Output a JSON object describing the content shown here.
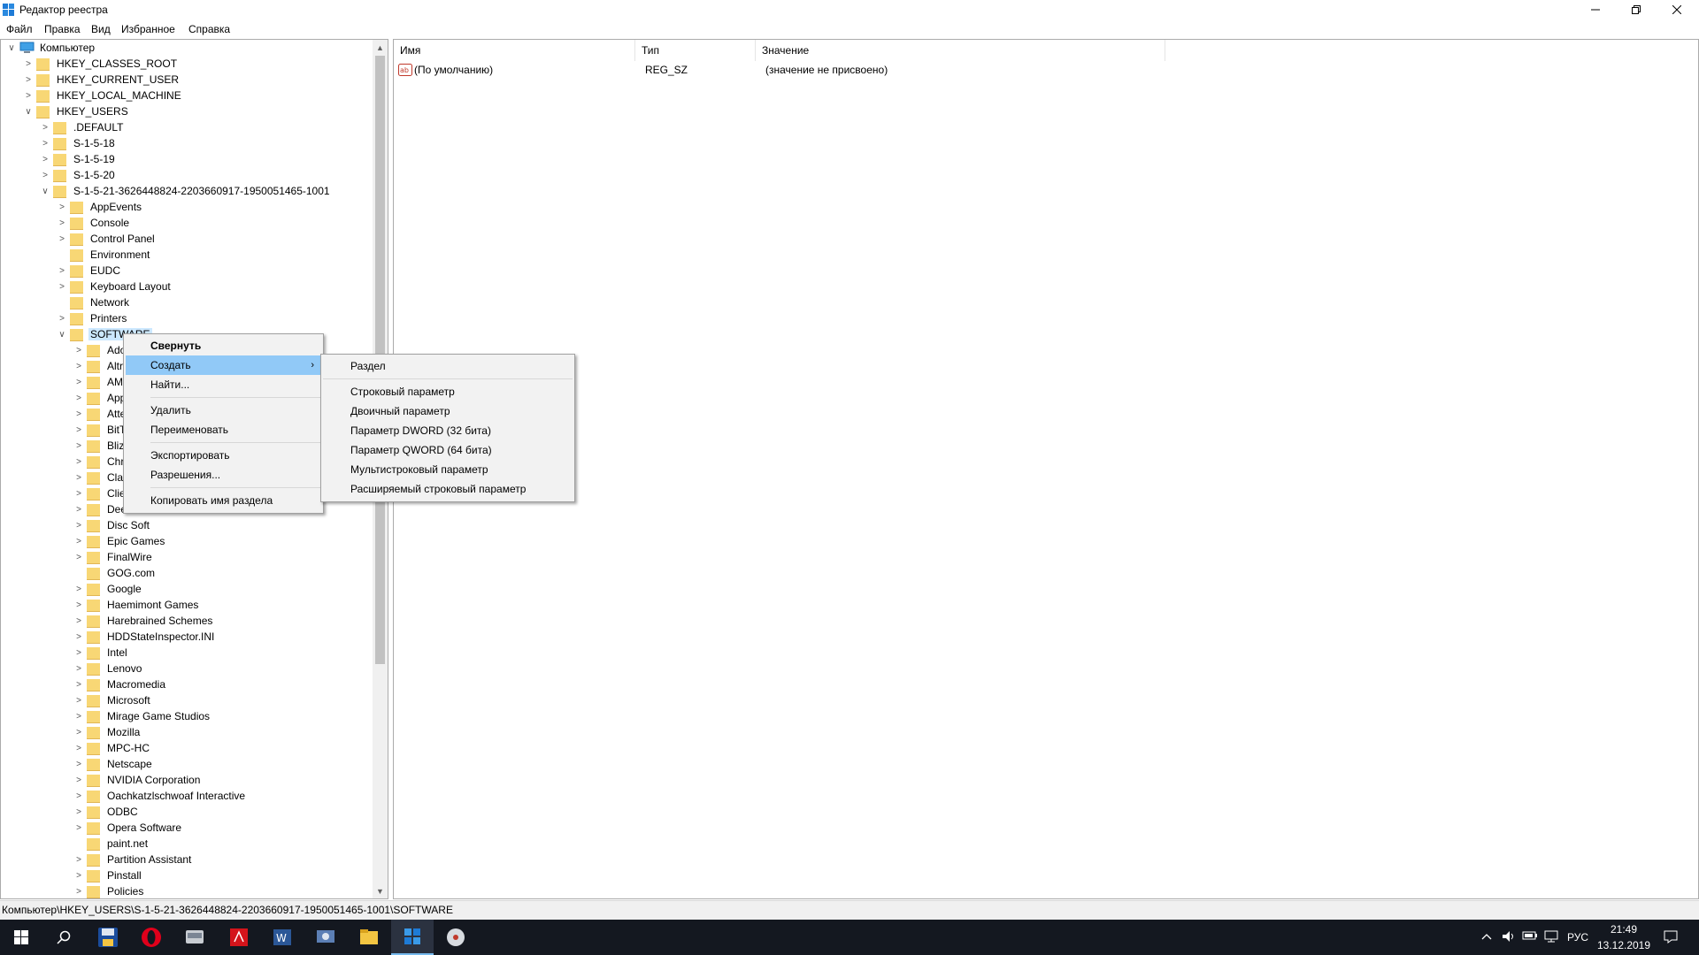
{
  "window": {
    "title": "Редактор реестра"
  },
  "menubar": [
    "Файл",
    "Правка",
    "Вид",
    "Избранное",
    "Справка"
  ],
  "tree": {
    "root": "Компьютер",
    "hives": [
      "HKEY_CLASSES_ROOT",
      "HKEY_CURRENT_USER",
      "HKEY_LOCAL_MACHINE",
      "HKEY_USERS"
    ],
    "users": [
      ".DEFAULT",
      "S-1-5-18",
      "S-1-5-19",
      "S-1-5-20",
      "S-1-5-21-3626448824-2203660917-1950051465-1001"
    ],
    "user_keys": [
      "AppEvents",
      "Console",
      "Control Panel",
      "Environment",
      "EUDC",
      "Keyboard Layout",
      "Network",
      "Printers",
      "SOFTWARE"
    ],
    "software_keys": [
      "Ado",
      "Altr",
      "AM",
      "App",
      "Atte",
      "BitT",
      "Bliz",
      "Chr",
      "Cla",
      "Clie",
      "Dee",
      "Disc Soft",
      "Epic Games",
      "FinalWire",
      "GOG.com",
      "Google",
      "Haemimont Games",
      "Harebrained Schemes",
      "HDDStateInspector.INI",
      "Intel",
      "Lenovo",
      "Macromedia",
      "Microsoft",
      "Mirage Game Studios",
      "Mozilla",
      "MPC-HC",
      "Netscape",
      "NVIDIA Corporation",
      "Oachkatzlschwoaf Interactive",
      "ODBC",
      "Opera Software",
      "paint.net",
      "Partition Assistant",
      "Pinstall",
      "Policies"
    ]
  },
  "values_table": {
    "headers": {
      "name": "Имя",
      "type": "Тип",
      "value": "Значение"
    },
    "rows": [
      {
        "name": "(По умолчанию)",
        "type": "REG_SZ",
        "value": "(значение не присвоено)"
      }
    ]
  },
  "context_menu": {
    "collapse": "Свернуть",
    "create": "Создать",
    "find": "Найти...",
    "delete": "Удалить",
    "rename": "Переименовать",
    "export": "Экспортировать",
    "permissions": "Разрешения...",
    "copy_key_name": "Копировать имя раздела"
  },
  "create_submenu": {
    "key": "Раздел",
    "string": "Строковый параметр",
    "binary": "Двоичный параметр",
    "dword": "Параметр DWORD (32 бита)",
    "qword": "Параметр QWORD (64 бита)",
    "multi_string": "Мультистроковый параметр",
    "expandable_string": "Расширяемый строковый параметр"
  },
  "statusbar": {
    "path": "Компьютер\\HKEY_USERS\\S-1-5-21-3626448824-2203660917-1950051465-1001\\SOFTWARE"
  },
  "taskbar": {
    "language": "РУС",
    "time": "21:49",
    "date": "13.12.2019",
    "apps": [
      "start-icon",
      "search-icon",
      "save-app-icon",
      "opera-icon",
      "scanner-app-icon",
      "acrobat-icon",
      "word-icon",
      "remote-app-icon",
      "explorer-icon",
      "regedit-icon",
      "disk-app-icon"
    ]
  },
  "colors": {
    "folder": "#f8d775",
    "selection": "#cce8ff",
    "menu_highlight": "#91c9f7",
    "taskbar": "#141820"
  }
}
